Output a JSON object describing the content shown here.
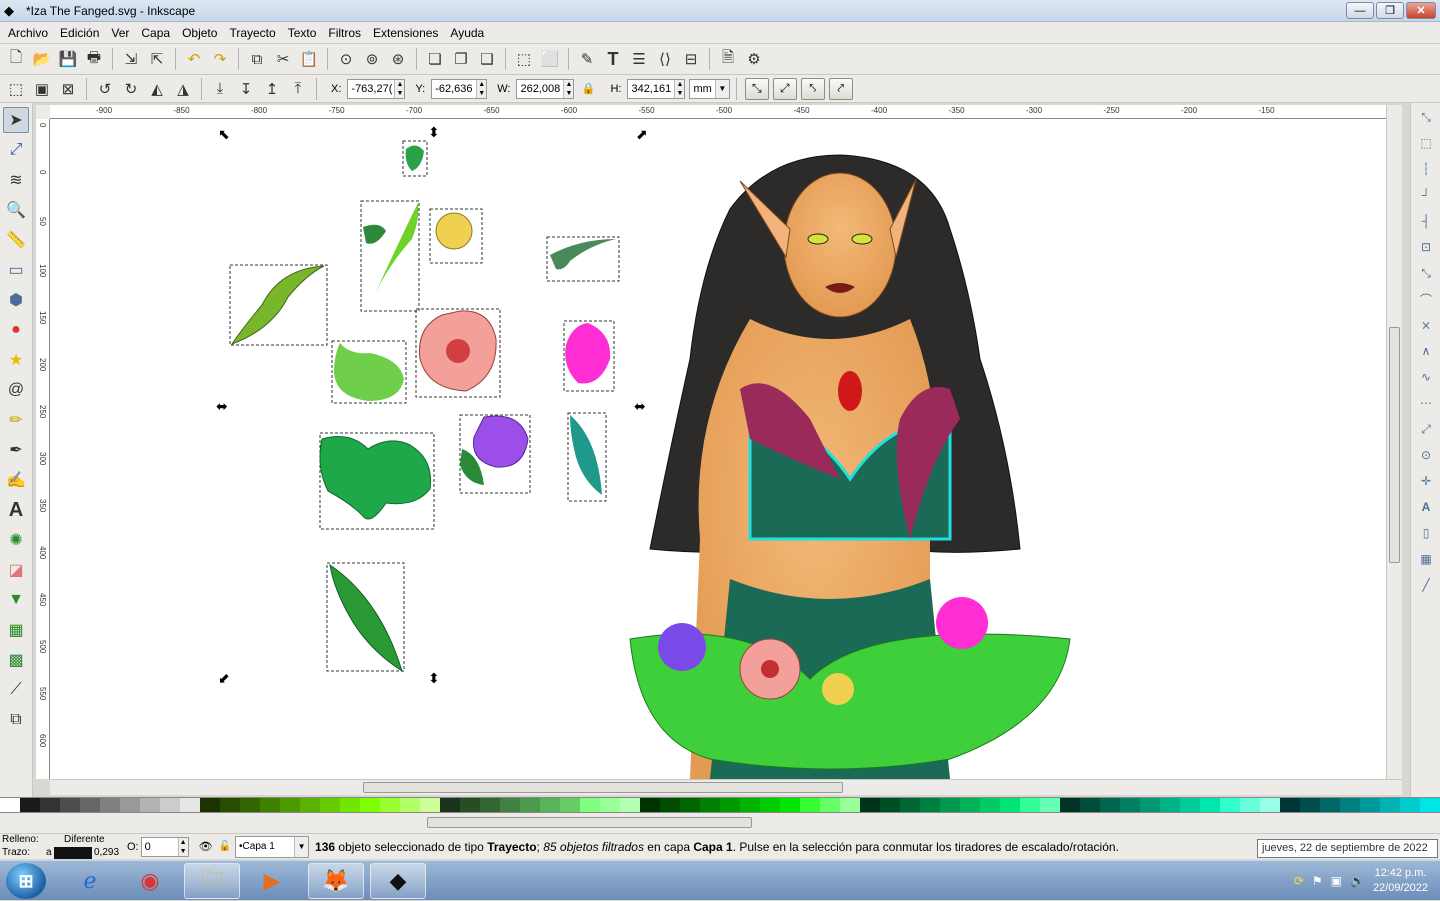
{
  "window": {
    "title": "*Iza The Fanged.svg - Inkscape",
    "minimize": "—",
    "maximize": "❐",
    "close": "✕"
  },
  "menu": [
    "Archivo",
    "Edición",
    "Ver",
    "Capa",
    "Objeto",
    "Trayecto",
    "Texto",
    "Filtros",
    "Extensiones",
    "Ayuda"
  ],
  "toolbar2": {
    "x_label": "X:",
    "x_value": "-763,27(",
    "y_label": "Y:",
    "y_value": "-62,636",
    "w_label": "W:",
    "w_value": "262,008",
    "h_label": "H:",
    "h_value": "342,161",
    "unit": "mm"
  },
  "ruler_h": [
    "-900",
    "-850",
    "-800",
    "-750",
    "-700",
    "-650",
    "-600",
    "-550",
    "-500",
    "-450",
    "-400",
    "-350",
    "-300",
    "-250",
    "-200",
    "-150"
  ],
  "ruler_v": [
    "0",
    "0",
    "50",
    "100",
    "150",
    "200",
    "250",
    "300",
    "350",
    "400",
    "450",
    "500",
    "550",
    "600"
  ],
  "status": {
    "fill_label": "Relleno:",
    "fill_value": "Diferente",
    "stroke_label": "Trazo:",
    "stroke_a": "a",
    "stroke_width": "0,293",
    "opacity_label": "O:",
    "opacity_value": "0",
    "layer": "•Capa 1",
    "msg_count": "136",
    "msg_text1": " objeto seleccionado de tipo ",
    "msg_type": "Trayecto",
    "msg_text2": "; ",
    "msg_filtered": "85 objetos filtrados",
    "msg_text3": "  en capa ",
    "msg_layer": "Capa 1",
    "msg_text4": ". Pulse en la selección para conmutar los tiradores de escalado/rotación."
  },
  "tooltip": "jueves, 22 de septiembre de 2022",
  "taskbar": {
    "time": "12:42 p.m.",
    "date": "22/09/2022"
  },
  "palette": [
    "#ffffff",
    "#1a1a1a",
    "#333333",
    "#4d4d4d",
    "#666666",
    "#808080",
    "#999999",
    "#b3b3b3",
    "#cccccc",
    "#e6e6e6",
    "#1a3300",
    "#264d00",
    "#336600",
    "#408000",
    "#4d9900",
    "#59b300",
    "#66cc00",
    "#73e600",
    "#80ff00",
    "#99ff33",
    "#b3ff66",
    "#ccff99",
    "#1a331a",
    "#264d26",
    "#336633",
    "#408040",
    "#4d994d",
    "#59b359",
    "#66cc66",
    "#80ff80",
    "#99ff99",
    "#b3ffb3",
    "#003300",
    "#004d00",
    "#006600",
    "#008000",
    "#009900",
    "#00b300",
    "#00cc00",
    "#00e600",
    "#33ff33",
    "#66ff66",
    "#99ff99",
    "#00331a",
    "#004d26",
    "#006633",
    "#008040",
    "#00994d",
    "#00b359",
    "#00cc66",
    "#00e673",
    "#33ff99",
    "#66ffb3",
    "#003326",
    "#004d39",
    "#00664d",
    "#008060",
    "#009973",
    "#00b386",
    "#00cc99",
    "#00e6ac",
    "#33ffcc",
    "#66ffd9",
    "#99ffe6",
    "#003333",
    "#004d4d",
    "#006666",
    "#008080",
    "#009999",
    "#00b3b3",
    "#00cccc",
    "#00e6e6"
  ]
}
